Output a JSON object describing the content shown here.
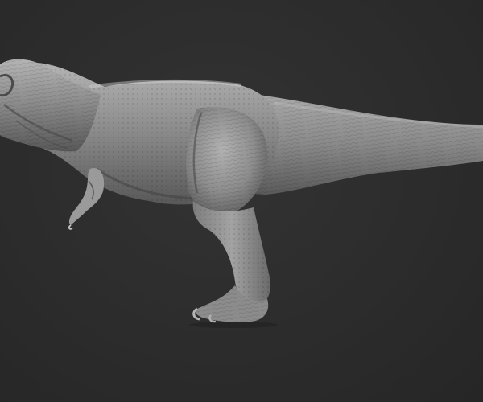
{
  "scene": {
    "subject": "t-rex-sculpt",
    "view": "side",
    "colors": {
      "background": "#2b2b2b",
      "skin_light": "#a9a9a9",
      "skin_mid": "#8a8a8a",
      "skin_dark": "#5e5e5e",
      "shadow": "#3c3c3c"
    }
  }
}
